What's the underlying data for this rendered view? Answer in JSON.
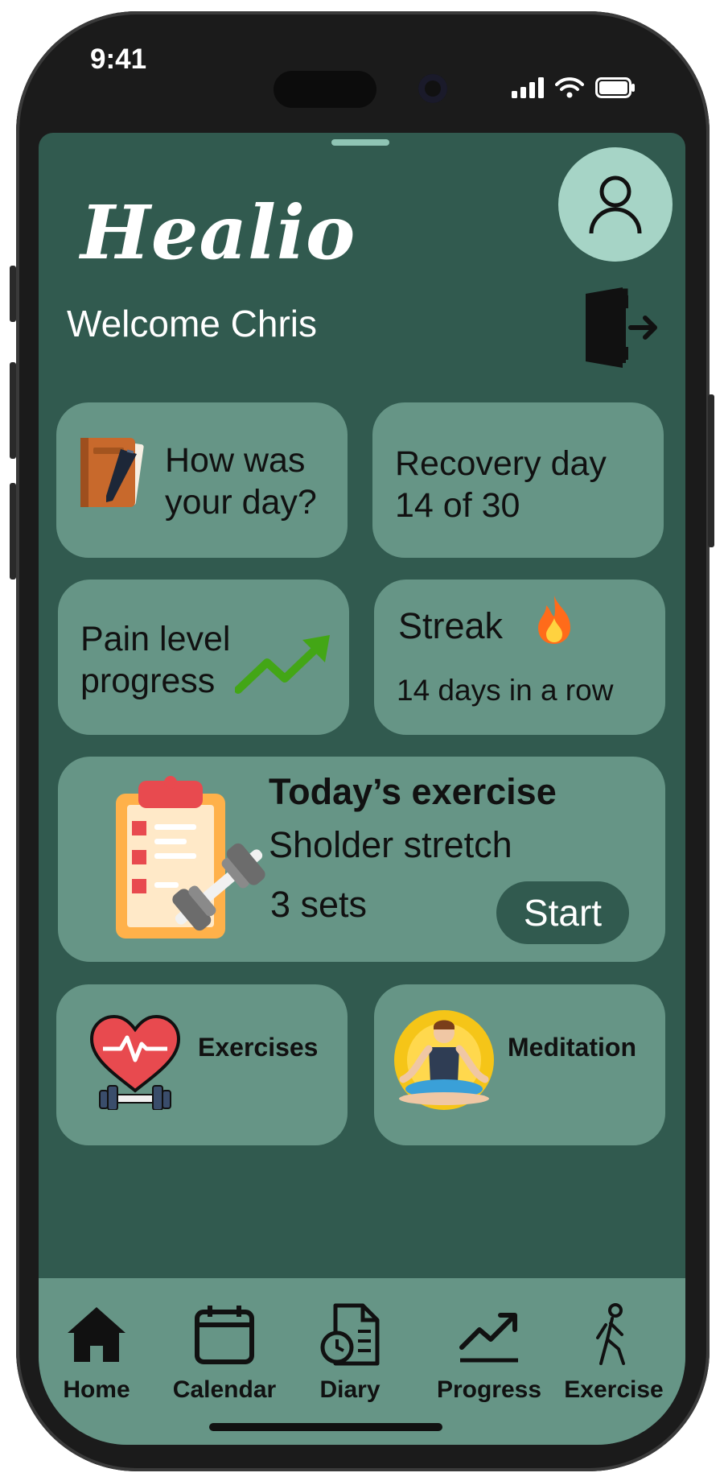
{
  "status_bar": {
    "time": "9:41"
  },
  "header": {
    "app_name": "Healio",
    "welcome": "Welcome Chris"
  },
  "cards": {
    "diary": {
      "line1": "How was",
      "line2": "your day?",
      "icon": "diary-notebook-icon"
    },
    "recovery": {
      "line1": "Recovery day",
      "line2": "14 of 30"
    },
    "pain": {
      "line1": "Pain level",
      "line2": "progress",
      "icon": "trend-up-arrow-icon"
    },
    "streak": {
      "title": "Streak",
      "subtitle": "14 days in a row",
      "icon": "fire-icon"
    },
    "today": {
      "title": "Today’s exercise",
      "exercise": "Sholder stretch",
      "sets": "3 sets",
      "start_label": "Start"
    },
    "exercises": {
      "label": "Exercises",
      "icon": "heart-dumbbell-icon"
    },
    "meditation": {
      "label": "Meditation",
      "icon": "meditation-icon"
    }
  },
  "tabbar": {
    "items": [
      {
        "label": "Home",
        "icon": "home-icon"
      },
      {
        "label": "Calendar",
        "icon": "calendar-icon"
      },
      {
        "label": "Diary",
        "icon": "diary-icon"
      },
      {
        "label": "Progress",
        "icon": "progress-icon"
      },
      {
        "label": "Exercise",
        "icon": "exercise-icon"
      }
    ]
  },
  "colors": {
    "background": "#315a4f",
    "card": "#669586",
    "avatar": "#a6d4c6"
  }
}
